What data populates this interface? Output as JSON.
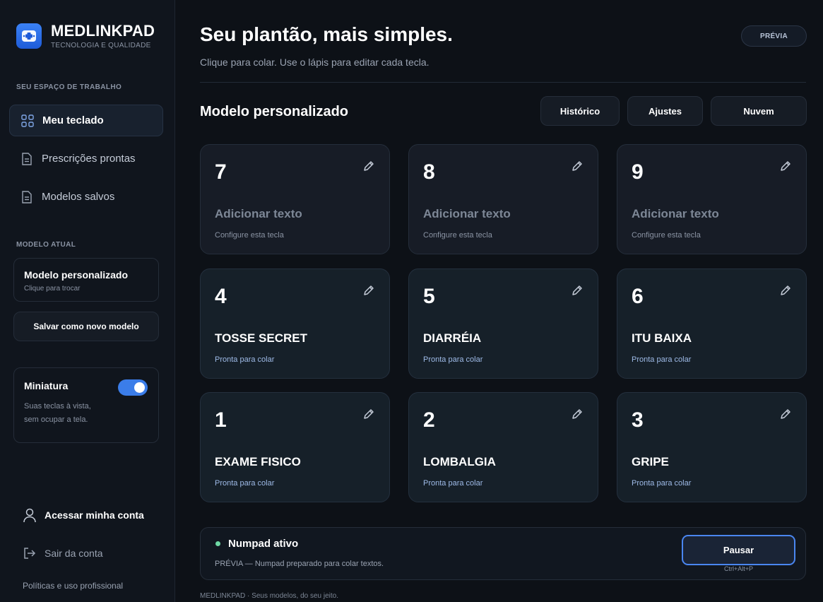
{
  "brand": {
    "name": "MEDLINKPAD",
    "tagline": "TECNOLOGIA E QUALIDADE",
    "accent": "#3b82f6"
  },
  "sidebar": {
    "workspace_label": "SEU ESPAÇO DE TRABALHO",
    "items": [
      {
        "label": "Meu teclado",
        "icon": "grid-icon",
        "active": true
      },
      {
        "label": "Prescrições prontas",
        "icon": "document-icon",
        "active": false
      },
      {
        "label": "Modelos salvos",
        "icon": "document-icon",
        "active": false
      }
    ],
    "current_model_label": "MODELO ATUAL",
    "current_model": {
      "title": "Modelo personalizado",
      "subtitle": "Clique para trocar"
    },
    "save_button": "Salvar como novo modelo",
    "miniature": {
      "title": "Miniatura",
      "description": "Suas teclas à vista,\nsem ocupar a tela.",
      "enabled": true
    },
    "account_label": "Acessar minha conta",
    "logout_label": "Sair da conta",
    "policies_label": "Políticas e uso profissional"
  },
  "header": {
    "title": "Seu plantão, mais simples.",
    "subtitle": "Clique para colar. Use o lápis para editar cada tecla.",
    "badge": "PRÉVIA"
  },
  "main": {
    "section_title": "Modelo personalizado",
    "buttons": {
      "history": "Histórico",
      "settings": "Ajustes",
      "cloud": "Nuvem"
    },
    "keys": [
      {
        "number": "7",
        "label": "Adicionar texto",
        "hint": "Configure esta tecla",
        "filled": false
      },
      {
        "number": "8",
        "label": "Adicionar texto",
        "hint": "Configure esta tecla",
        "filled": false
      },
      {
        "number": "9",
        "label": "Adicionar texto",
        "hint": "Configure esta tecla",
        "filled": false
      },
      {
        "number": "4",
        "label": "TOSSE SECRET",
        "hint": "Pronta para colar",
        "filled": true
      },
      {
        "number": "5",
        "label": "DIARRÉIA",
        "hint": "Pronta para colar",
        "filled": true
      },
      {
        "number": "6",
        "label": "ITU BAIXA",
        "hint": "Pronta para colar",
        "filled": true
      },
      {
        "number": "1",
        "label": "EXAME FISICO",
        "hint": "Pronta para colar",
        "filled": true
      },
      {
        "number": "2",
        "label": "LOMBALGIA",
        "hint": "Pronta para colar",
        "filled": true
      },
      {
        "number": "3",
        "label": "GRIPE",
        "hint": "Pronta para colar",
        "filled": true
      }
    ]
  },
  "status": {
    "title": "Numpad ativo",
    "subtitle": "PRÉVIA — Numpad preparado para colar textos.",
    "pause_button": "Pausar",
    "shortcut": "Ctrl+Alt+P",
    "indicator_color": "#6ed8a4"
  },
  "footer": "MEDLINKPAD · Seus modelos, do seu jeito."
}
